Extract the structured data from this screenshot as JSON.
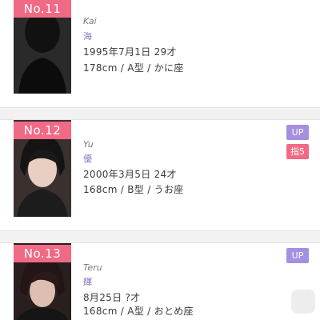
{
  "colors": {
    "number_badge": "#f06a86",
    "up_tag": "#a48fe0",
    "rank_tag": "#f06a86",
    "kanji_name": "#8a72b8"
  },
  "cast": [
    {
      "number": "No.11",
      "name_roman": "Kai",
      "name_kanji": "海",
      "birth": "1995年7月1日 29才",
      "details": "178cm / A型 / かに座",
      "tags": []
    },
    {
      "number": "No.12",
      "name_roman": "Yu",
      "name_kanji": "優",
      "birth": "2000年3月5日 24才",
      "details": "168cm / B型 / うお座",
      "tags": [
        "UP",
        "指5"
      ]
    },
    {
      "number": "No.13",
      "name_roman": "Teru",
      "name_kanji": "輝",
      "birth": "8月25日 ?才",
      "details": "168cm / A型 / おとめ座",
      "tags": [
        "UP"
      ]
    }
  ],
  "icons": {
    "watermark": "app-watermark-icon"
  }
}
